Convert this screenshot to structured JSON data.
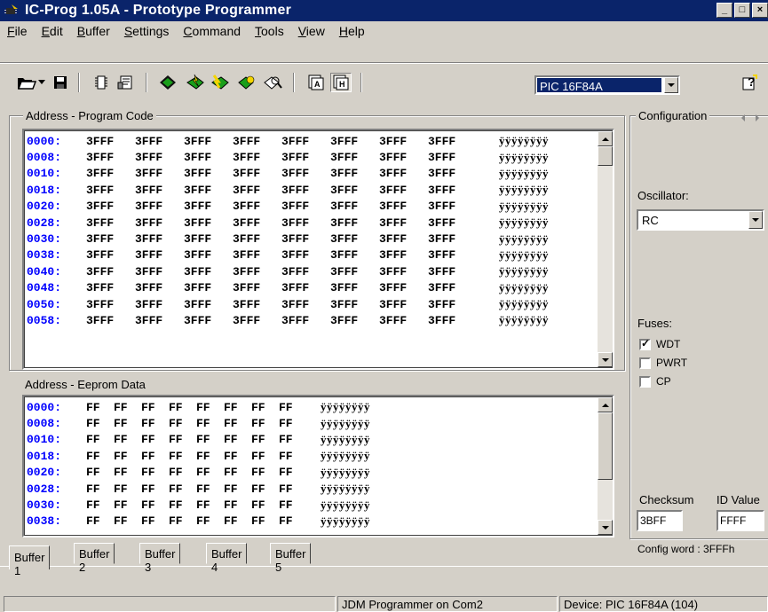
{
  "window": {
    "title": "IC-Prog 1.05A - Prototype Programmer"
  },
  "menu": [
    {
      "ul": "F",
      "rest": "ile"
    },
    {
      "ul": "E",
      "rest": "dit"
    },
    {
      "ul": "B",
      "rest": "uffer"
    },
    {
      "ul": "S",
      "rest": "ettings"
    },
    {
      "ul": "C",
      "rest": "ommand"
    },
    {
      "ul": "T",
      "rest": "ools"
    },
    {
      "ul": "V",
      "rest": "iew"
    },
    {
      "ul": "H",
      "rest": "elp"
    }
  ],
  "device": {
    "selected": "PIC 16F84A"
  },
  "program": {
    "label": "Address - Program Code",
    "rows": [
      {
        "addr": "0000:",
        "words": [
          "3FFF",
          "3FFF",
          "3FFF",
          "3FFF",
          "3FFF",
          "3FFF",
          "3FFF",
          "3FFF"
        ],
        "ascii": "ÿÿÿÿÿÿÿÿ"
      },
      {
        "addr": "0008:",
        "words": [
          "3FFF",
          "3FFF",
          "3FFF",
          "3FFF",
          "3FFF",
          "3FFF",
          "3FFF",
          "3FFF"
        ],
        "ascii": "ÿÿÿÿÿÿÿÿ"
      },
      {
        "addr": "0010:",
        "words": [
          "3FFF",
          "3FFF",
          "3FFF",
          "3FFF",
          "3FFF",
          "3FFF",
          "3FFF",
          "3FFF"
        ],
        "ascii": "ÿÿÿÿÿÿÿÿ"
      },
      {
        "addr": "0018:",
        "words": [
          "3FFF",
          "3FFF",
          "3FFF",
          "3FFF",
          "3FFF",
          "3FFF",
          "3FFF",
          "3FFF"
        ],
        "ascii": "ÿÿÿÿÿÿÿÿ"
      },
      {
        "addr": "0020:",
        "words": [
          "3FFF",
          "3FFF",
          "3FFF",
          "3FFF",
          "3FFF",
          "3FFF",
          "3FFF",
          "3FFF"
        ],
        "ascii": "ÿÿÿÿÿÿÿÿ"
      },
      {
        "addr": "0028:",
        "words": [
          "3FFF",
          "3FFF",
          "3FFF",
          "3FFF",
          "3FFF",
          "3FFF",
          "3FFF",
          "3FFF"
        ],
        "ascii": "ÿÿÿÿÿÿÿÿ"
      },
      {
        "addr": "0030:",
        "words": [
          "3FFF",
          "3FFF",
          "3FFF",
          "3FFF",
          "3FFF",
          "3FFF",
          "3FFF",
          "3FFF"
        ],
        "ascii": "ÿÿÿÿÿÿÿÿ"
      },
      {
        "addr": "0038:",
        "words": [
          "3FFF",
          "3FFF",
          "3FFF",
          "3FFF",
          "3FFF",
          "3FFF",
          "3FFF",
          "3FFF"
        ],
        "ascii": "ÿÿÿÿÿÿÿÿ"
      },
      {
        "addr": "0040:",
        "words": [
          "3FFF",
          "3FFF",
          "3FFF",
          "3FFF",
          "3FFF",
          "3FFF",
          "3FFF",
          "3FFF"
        ],
        "ascii": "ÿÿÿÿÿÿÿÿ"
      },
      {
        "addr": "0048:",
        "words": [
          "3FFF",
          "3FFF",
          "3FFF",
          "3FFF",
          "3FFF",
          "3FFF",
          "3FFF",
          "3FFF"
        ],
        "ascii": "ÿÿÿÿÿÿÿÿ"
      },
      {
        "addr": "0050:",
        "words": [
          "3FFF",
          "3FFF",
          "3FFF",
          "3FFF",
          "3FFF",
          "3FFF",
          "3FFF",
          "3FFF"
        ],
        "ascii": "ÿÿÿÿÿÿÿÿ"
      },
      {
        "addr": "0058:",
        "words": [
          "3FFF",
          "3FFF",
          "3FFF",
          "3FFF",
          "3FFF",
          "3FFF",
          "3FFF",
          "3FFF"
        ],
        "ascii": "ÿÿÿÿÿÿÿÿ"
      }
    ]
  },
  "eeprom": {
    "label": "Address - Eeprom Data",
    "rows": [
      {
        "addr": "0000:",
        "bytes": [
          "FF",
          "FF",
          "FF",
          "FF",
          "FF",
          "FF",
          "FF",
          "FF"
        ],
        "ascii": "ÿÿÿÿÿÿÿÿ"
      },
      {
        "addr": "0008:",
        "bytes": [
          "FF",
          "FF",
          "FF",
          "FF",
          "FF",
          "FF",
          "FF",
          "FF"
        ],
        "ascii": "ÿÿÿÿÿÿÿÿ"
      },
      {
        "addr": "0010:",
        "bytes": [
          "FF",
          "FF",
          "FF",
          "FF",
          "FF",
          "FF",
          "FF",
          "FF"
        ],
        "ascii": "ÿÿÿÿÿÿÿÿ"
      },
      {
        "addr": "0018:",
        "bytes": [
          "FF",
          "FF",
          "FF",
          "FF",
          "FF",
          "FF",
          "FF",
          "FF"
        ],
        "ascii": "ÿÿÿÿÿÿÿÿ"
      },
      {
        "addr": "0020:",
        "bytes": [
          "FF",
          "FF",
          "FF",
          "FF",
          "FF",
          "FF",
          "FF",
          "FF"
        ],
        "ascii": "ÿÿÿÿÿÿÿÿ"
      },
      {
        "addr": "0028:",
        "bytes": [
          "FF",
          "FF",
          "FF",
          "FF",
          "FF",
          "FF",
          "FF",
          "FF"
        ],
        "ascii": "ÿÿÿÿÿÿÿÿ"
      },
      {
        "addr": "0030:",
        "bytes": [
          "FF",
          "FF",
          "FF",
          "FF",
          "FF",
          "FF",
          "FF",
          "FF"
        ],
        "ascii": "ÿÿÿÿÿÿÿÿ"
      },
      {
        "addr": "0038:",
        "bytes": [
          "FF",
          "FF",
          "FF",
          "FF",
          "FF",
          "FF",
          "FF",
          "FF"
        ],
        "ascii": "ÿÿÿÿÿÿÿÿ"
      }
    ]
  },
  "config": {
    "label": "Configuration",
    "oscillator_label": "Oscillator:",
    "oscillator_value": "RC",
    "fuses_label": "Fuses:",
    "fuses": [
      {
        "name": "WDT",
        "checked": true
      },
      {
        "name": "PWRT",
        "checked": false
      },
      {
        "name": "CP",
        "checked": false
      }
    ],
    "checksum_label": "Checksum",
    "checksum_value": "3BFF",
    "id_label": "ID Value",
    "id_value": "FFFF",
    "config_word": "Config word : 3FFFh"
  },
  "tabs": [
    "Buffer 1",
    "Buffer 2",
    "Buffer 3",
    "Buffer 4",
    "Buffer 5"
  ],
  "status": {
    "left": "",
    "programmer": "JDM Programmer on Com2",
    "device": "Device: PIC 16F84A  (104)"
  },
  "colors": {
    "title_bg": "#0a246a",
    "address_blue": "#0000ff",
    "face": "#d4d0c8"
  }
}
